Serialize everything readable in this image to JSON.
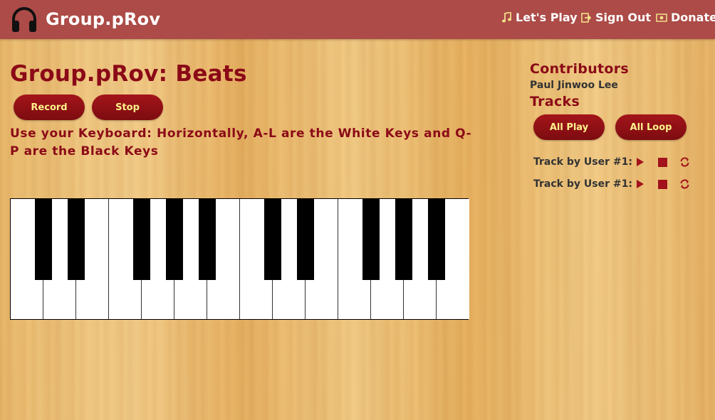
{
  "nav": {
    "brand": "Group.pRov",
    "links": [
      {
        "label": "Let's Play",
        "icon": "music-note-icon"
      },
      {
        "label": "Sign Out",
        "icon": "sign-out-icon"
      },
      {
        "label": "Donate",
        "icon": "money-icon"
      }
    ]
  },
  "main": {
    "title": "Group.pRov: Beats",
    "record_label": "Record",
    "stop_label": "Stop",
    "instructions": "Use your Keyboard: Horizontally, A-L are the White Keys and Q-P are the Black Keys"
  },
  "sidebar": {
    "contributors_heading": "Contributors",
    "contributors": [
      "Paul Jinwoo Lee"
    ],
    "tracks_heading": "Tracks",
    "all_play_label": "All Play",
    "all_loop_label": "All Loop",
    "tracks": [
      {
        "label": "Track by User #1:"
      },
      {
        "label": "Track by User #1:"
      }
    ]
  },
  "piano": {
    "white_key_count": 14,
    "black_key_count": 10
  },
  "colors": {
    "navbar": "#ac4b47",
    "heading": "#8b0a17",
    "button": "#8c1014",
    "button_text": "#fff18a"
  }
}
